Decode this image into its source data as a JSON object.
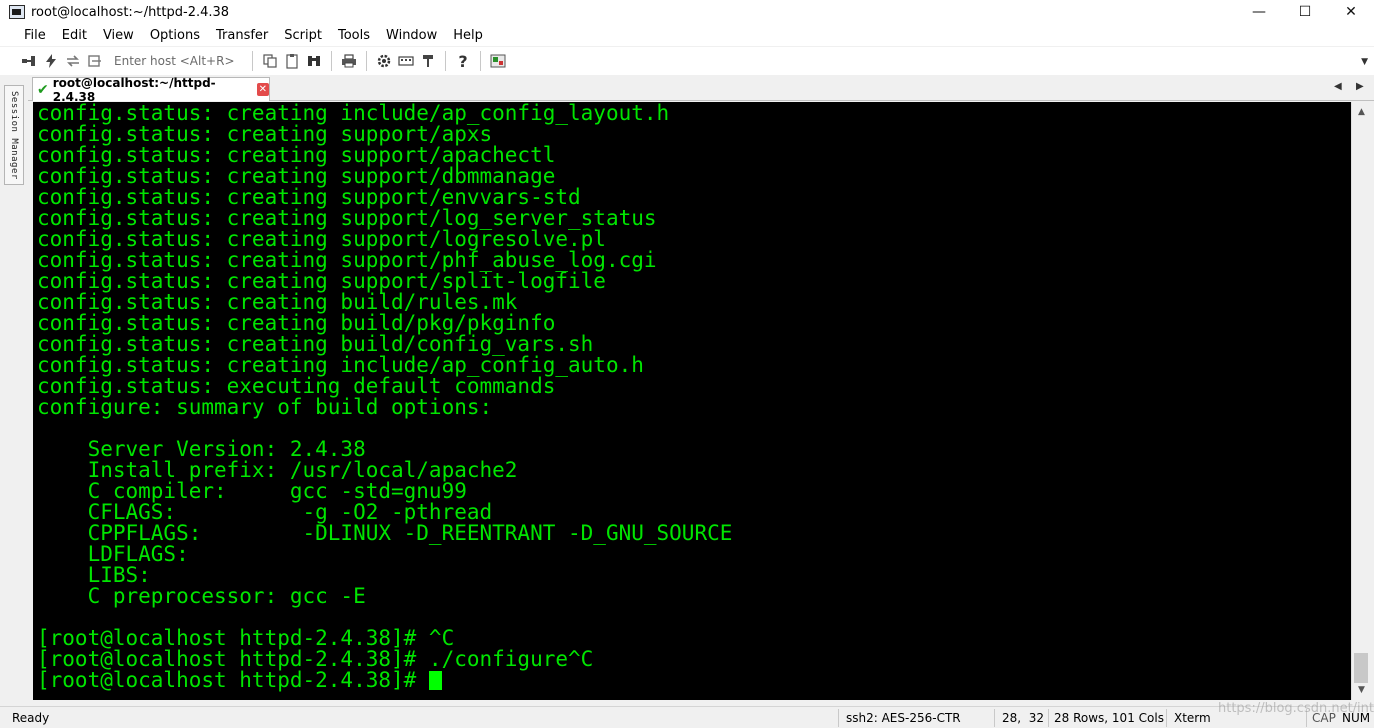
{
  "window": {
    "title": "root@localhost:~/httpd-2.4.38",
    "controls": {
      "minimize": "—",
      "maximize": "☐",
      "close": "✕"
    }
  },
  "menu": [
    "File",
    "Edit",
    "View",
    "Options",
    "Transfer",
    "Script",
    "Tools",
    "Window",
    "Help"
  ],
  "toolbar": {
    "host_placeholder": "Enter host <Alt+R>",
    "icons": [
      "connect-icon",
      "quick-connect-icon",
      "reconnect-icon",
      "copy-icon",
      "paste-icon",
      "find-icon",
      "print-icon",
      "settings-icon",
      "keymap-icon",
      "sftp-icon",
      "help-icon",
      "script-icon"
    ]
  },
  "session_manager": {
    "label": "Session Manager"
  },
  "tab": {
    "label": "root@localhost:~/httpd-2.4.38",
    "status_color": "#1f9b1f"
  },
  "terminal": {
    "fg": "#00e500",
    "bg": "#000000",
    "lines": [
      "config.status: creating include/ap_config_layout.h",
      "config.status: creating support/apxs",
      "config.status: creating support/apachectl",
      "config.status: creating support/dbmmanage",
      "config.status: creating support/envvars-std",
      "config.status: creating support/log_server_status",
      "config.status: creating support/logresolve.pl",
      "config.status: creating support/phf_abuse_log.cgi",
      "config.status: creating support/split-logfile",
      "config.status: creating build/rules.mk",
      "config.status: creating build/pkg/pkginfo",
      "config.status: creating build/config_vars.sh",
      "config.status: creating include/ap_config_auto.h",
      "config.status: executing default commands",
      "configure: summary of build options:",
      "",
      "    Server Version: 2.4.38",
      "    Install prefix: /usr/local/apache2",
      "    C compiler:     gcc -std=gnu99",
      "    CFLAGS:          -g -O2 -pthread",
      "    CPPFLAGS:        -DLINUX -D_REENTRANT -D_GNU_SOURCE",
      "    LDFLAGS:",
      "    LIBS:",
      "    C preprocessor: gcc -E",
      "",
      "[root@localhost httpd-2.4.38]# ^C",
      "[root@localhost httpd-2.4.38]# ./configure^C"
    ],
    "prompt": "[root@localhost httpd-2.4.38]# "
  },
  "status": {
    "ready": "Ready",
    "cipher": "ssh2: AES-256-CTR",
    "cursor_pos": "28,  32",
    "size": "28 Rows, 101 Cols",
    "term_type": "Xterm",
    "caps": "CAP",
    "num": "NUM",
    "watermark": "https://blog.csdn.net/intern_lin0"
  }
}
